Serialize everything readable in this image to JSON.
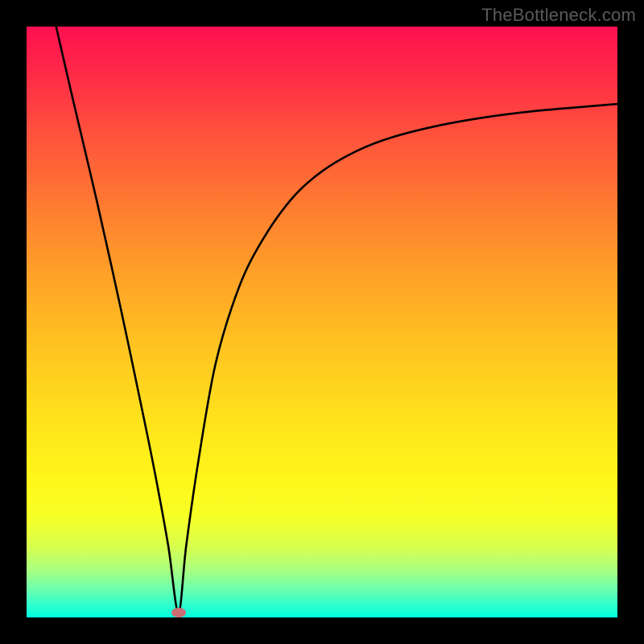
{
  "watermark": "TheBottleneck.com",
  "chart_data": {
    "type": "line",
    "title": "",
    "xlabel": "",
    "ylabel": "",
    "xlim": [
      0,
      100
    ],
    "ylim": [
      0,
      100
    ],
    "series": [
      {
        "name": "curve",
        "x": [
          5,
          8,
          12,
          16,
          20,
          22,
          24,
          25.7,
          27,
          29,
          32,
          36,
          40,
          45,
          50,
          56,
          62,
          70,
          78,
          86,
          94,
          100
        ],
        "y": [
          100,
          87,
          70,
          52,
          33,
          23,
          12,
          0.8,
          12,
          26,
          43,
          56,
          64,
          71,
          75.5,
          79,
          81.3,
          83.3,
          84.7,
          85.7,
          86.4,
          86.9
        ]
      }
    ],
    "marker": {
      "x": 25.7,
      "y": 0.8
    },
    "background_gradient": {
      "top": "#ff1050",
      "mid": "#ffd21e",
      "bottom": "#00ffdf"
    },
    "frame_color": "#000000"
  }
}
